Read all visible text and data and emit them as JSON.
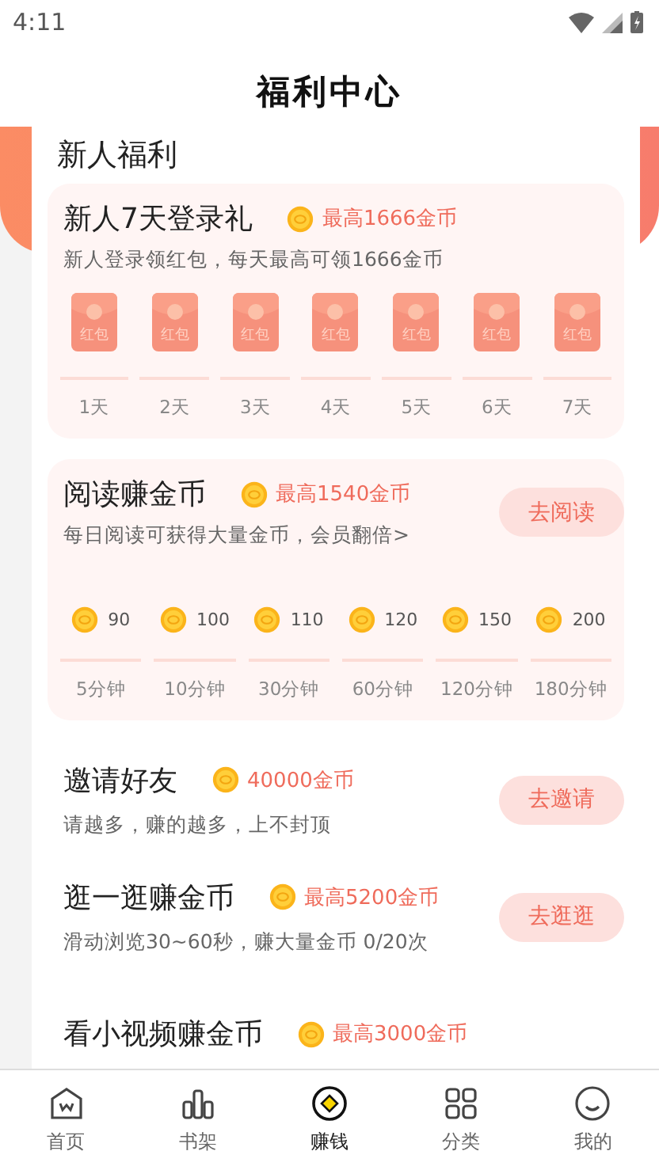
{
  "status_bar": {
    "time": "4:11"
  },
  "header": {
    "title": "福利中心"
  },
  "sheet": {
    "title": "新人福利",
    "login_card": {
      "title": "新人7天登录礼",
      "reward": "最高1666金币",
      "subtitle": "新人登录领红包，每天最高可领1666金币",
      "days": [
        {
          "packet_label": "红包",
          "day": "1天"
        },
        {
          "packet_label": "红包",
          "day": "2天"
        },
        {
          "packet_label": "红包",
          "day": "3天"
        },
        {
          "packet_label": "红包",
          "day": "4天"
        },
        {
          "packet_label": "红包",
          "day": "5天"
        },
        {
          "packet_label": "红包",
          "day": "6天"
        },
        {
          "packet_label": "红包",
          "day": "7天"
        }
      ]
    },
    "reading_card": {
      "title": "阅读赚金币",
      "reward": "最高1540金币",
      "subtitle": "每日阅读可获得大量金币，会员翻倍>",
      "button": "去阅读",
      "steps": [
        {
          "amount": "90",
          "time": "5分钟"
        },
        {
          "amount": "100",
          "time": "10分钟"
        },
        {
          "amount": "110",
          "time": "30分钟"
        },
        {
          "amount": "120",
          "time": "60分钟"
        },
        {
          "amount": "150",
          "time": "120分钟"
        },
        {
          "amount": "200",
          "time": "180分钟"
        }
      ]
    },
    "tasks": [
      {
        "title": "邀请好友",
        "reward": "40000金币",
        "subtitle": "请越多，赚的越多，上不封顶",
        "button": "去邀请"
      },
      {
        "title": "逛一逛赚金币",
        "reward": "最高5200金币",
        "subtitle": "滑动浏览30~60秒，赚大量金币 0/20次",
        "button": "去逛逛"
      },
      {
        "title": "看小视频赚金币",
        "reward": "最高3000金币"
      }
    ]
  },
  "bottom_nav": [
    {
      "label": "首页",
      "selected": false
    },
    {
      "label": "书架",
      "selected": false
    },
    {
      "label": "赚钱",
      "selected": true
    },
    {
      "label": "分类",
      "selected": false
    },
    {
      "label": "我的",
      "selected": false
    }
  ]
}
